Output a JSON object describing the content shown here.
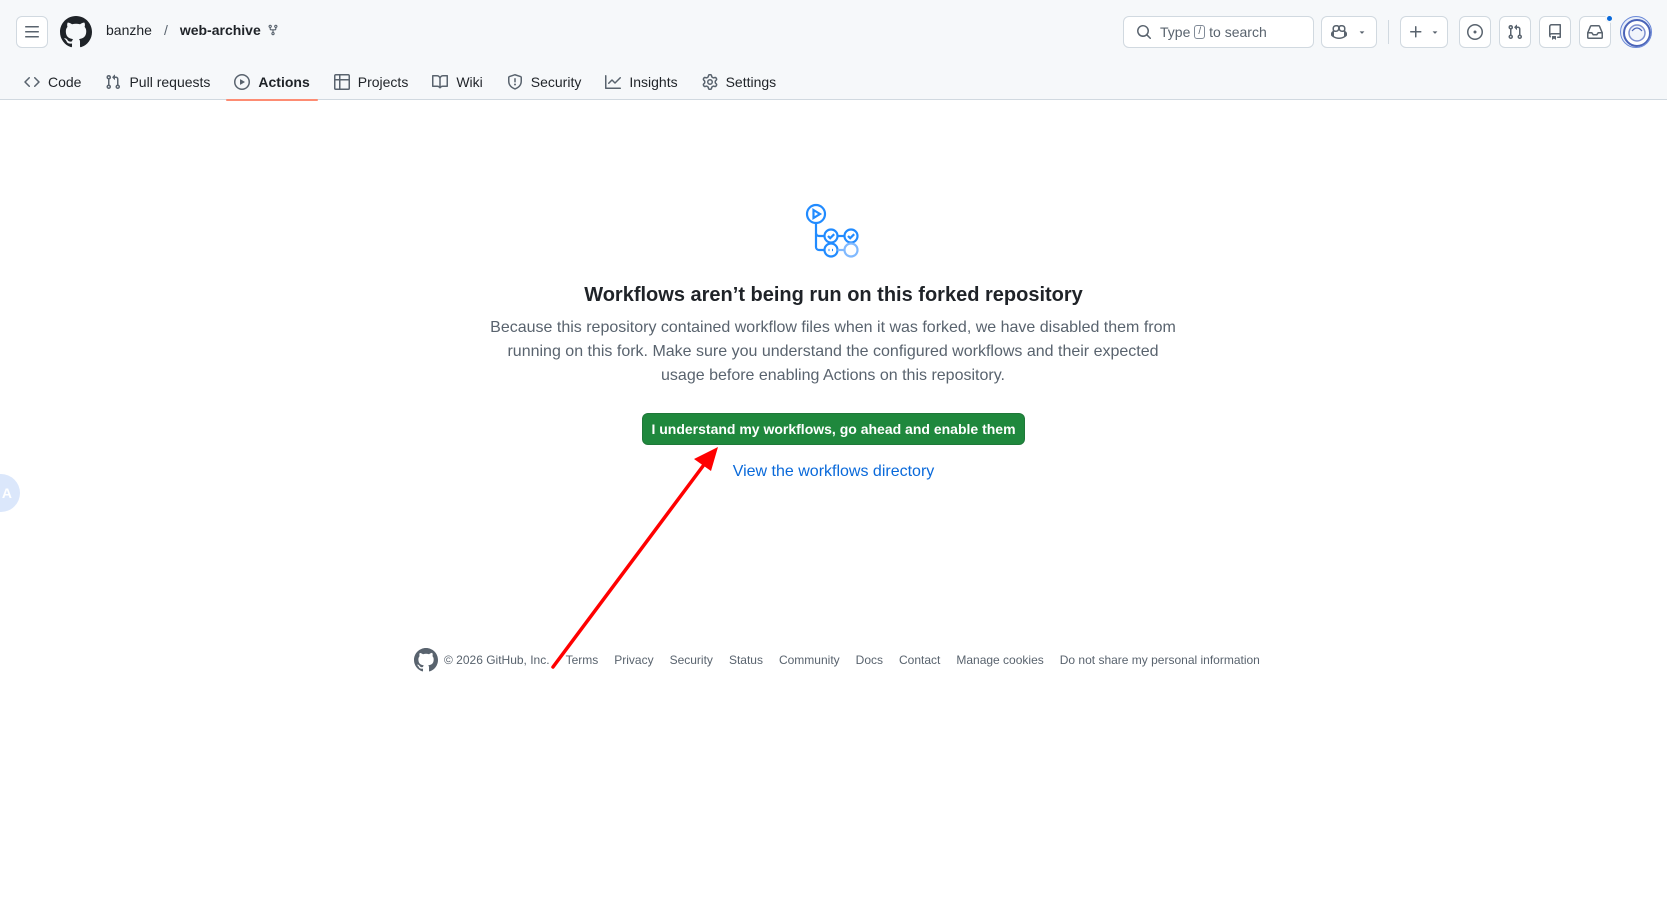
{
  "header": {
    "owner": "banzhe",
    "separator": "/",
    "repo": "web-archive",
    "search": {
      "prefix": "Type",
      "key": "/",
      "suffix": "to search"
    }
  },
  "tabs": [
    {
      "label": "Code",
      "icon": "code-icon"
    },
    {
      "label": "Pull requests",
      "icon": "git-pull-request-icon"
    },
    {
      "label": "Actions",
      "icon": "play-icon",
      "active": true
    },
    {
      "label": "Projects",
      "icon": "table-icon"
    },
    {
      "label": "Wiki",
      "icon": "book-icon"
    },
    {
      "label": "Security",
      "icon": "shield-icon"
    },
    {
      "label": "Insights",
      "icon": "graph-icon"
    },
    {
      "label": "Settings",
      "icon": "gear-icon"
    }
  ],
  "main": {
    "title": "Workflows aren’t being run on this forked repository",
    "description": "Because this repository contained workflow files when it was forked, we have disabled them from running on this fork. Make sure you understand the configured workflows and their expected usage before enabling Actions on this repository.",
    "enable_button": "I understand my workflows, go ahead and enable them",
    "directory_link": "View the workflows directory"
  },
  "footer": {
    "copyright": "© 2026 GitHub, Inc.",
    "links": [
      "Terms",
      "Privacy",
      "Security",
      "Status",
      "Community",
      "Docs",
      "Contact",
      "Manage cookies",
      "Do not share my personal information"
    ]
  },
  "side_bubble": {
    "label": "A"
  },
  "colors": {
    "primary_button": "#1f883d",
    "link": "#0969da",
    "active_tab_underline": "#fd8c73",
    "annotation_arrow": "#ff0000"
  }
}
